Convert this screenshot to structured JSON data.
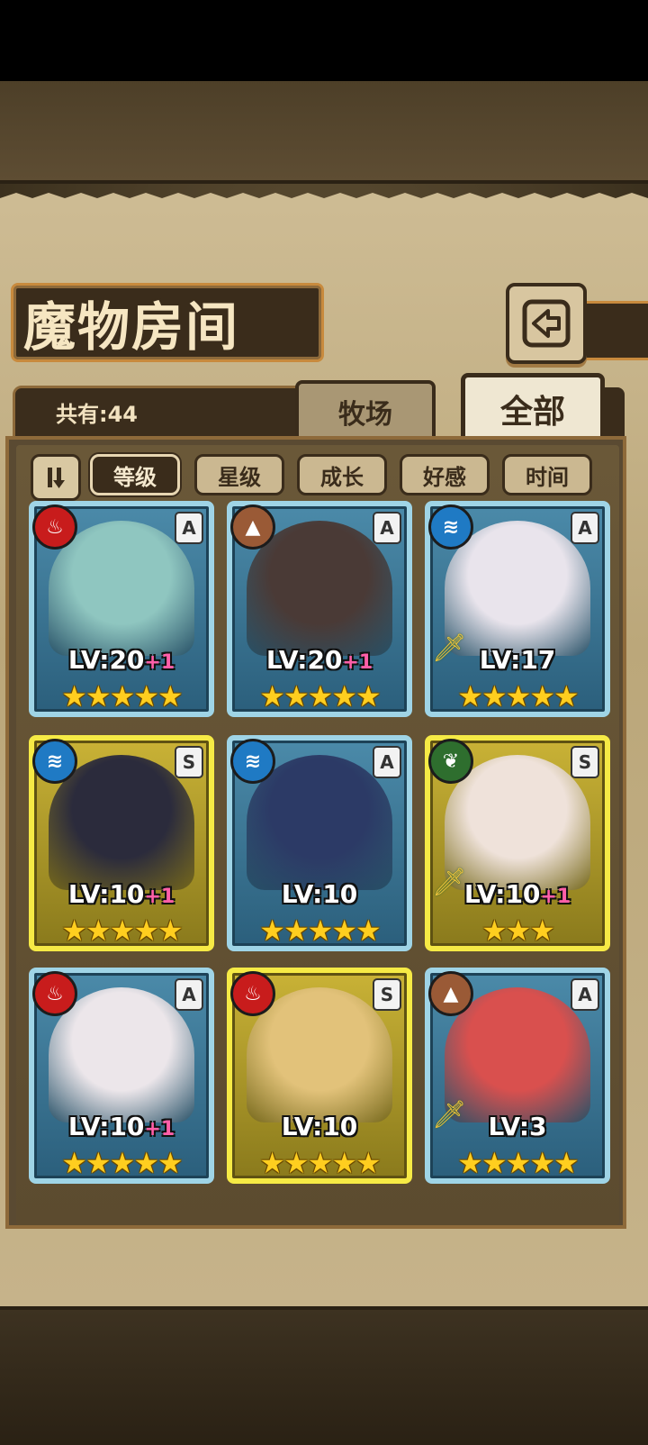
{
  "header": {
    "title": "魔物房间"
  },
  "count": {
    "label": "共有:44"
  },
  "tabs": [
    {
      "label": "牧场"
    },
    {
      "label": "全部"
    }
  ],
  "sort": {
    "toggle_icon": "sort-toggle-icon",
    "filters": [
      {
        "label": "等级",
        "active": true
      },
      {
        "label": "星级",
        "active": false
      },
      {
        "label": "成长",
        "active": false
      },
      {
        "label": "好感",
        "active": false
      },
      {
        "label": "时间",
        "active": false
      }
    ]
  },
  "monsters": [
    {
      "element": "fire",
      "rank": "A",
      "frame": "blue",
      "level": "LV:20",
      "plus": "+1",
      "stars": "★★★★★",
      "portrait_color": "#8fc6c0"
    },
    {
      "element": "earth",
      "rank": "A",
      "frame": "blue",
      "level": "LV:20",
      "plus": "+1",
      "stars": "★★★★★",
      "portrait_color": "#4a3a36"
    },
    {
      "element": "water",
      "rank": "A",
      "frame": "blue",
      "level": "LV:17",
      "plus": "",
      "stars": "★★★★★",
      "portrait_color": "#e9e4ec",
      "weapon": true
    },
    {
      "element": "water",
      "rank": "S",
      "frame": "gold",
      "level": "LV:10",
      "plus": "+1",
      "stars": "★★★★★",
      "portrait_color": "#2b2b3c"
    },
    {
      "element": "water",
      "rank": "A",
      "frame": "blue",
      "level": "LV:10",
      "plus": "",
      "stars": "★★★★★",
      "portrait_color": "#2c3a66"
    },
    {
      "element": "leaf",
      "rank": "S",
      "frame": "gold",
      "level": "LV:10",
      "plus": "+1",
      "stars": "★★★",
      "portrait_color": "#efe2da",
      "weapon": true
    },
    {
      "element": "fire",
      "rank": "A",
      "frame": "blue",
      "level": "LV:10",
      "plus": "+1",
      "stars": "★★★★★",
      "portrait_color": "#ece6ea"
    },
    {
      "element": "fire",
      "rank": "S",
      "frame": "gold",
      "level": "LV:10",
      "plus": "",
      "stars": "★★★★★",
      "portrait_color": "#e2c27a"
    },
    {
      "element": "earth",
      "rank": "A",
      "frame": "blue",
      "level": "LV:3",
      "plus": "",
      "stars": "★★★★★",
      "portrait_color": "#d9504e",
      "weapon": true
    }
  ],
  "colors": {
    "fire": "#c81c1c",
    "earth": "#9a5a36",
    "water": "#1f7ac4",
    "leaf": "#2e6e2e",
    "blue_frame": "#9fd4e6",
    "gold_frame": "#f6ea45",
    "plus_level": "#ff5fa8"
  }
}
